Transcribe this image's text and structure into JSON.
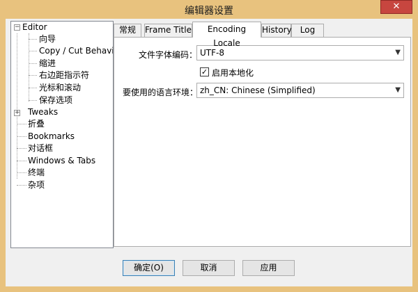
{
  "window": {
    "title": "编辑器设置",
    "close_label": "✕"
  },
  "tree": {
    "items": [
      {
        "label": "Editor",
        "expander": "⊟"
      },
      {
        "label": "向导"
      },
      {
        "label": "Copy / Cut Behavior"
      },
      {
        "label": "缩进"
      },
      {
        "label": "右边距指示符"
      },
      {
        "label": "光标和滚动"
      },
      {
        "label": "保存选项"
      },
      {
        "label": "Tweaks",
        "expander": "⊞"
      },
      {
        "label": "折叠"
      },
      {
        "label": "Bookmarks"
      },
      {
        "label": "对话框"
      },
      {
        "label": "Windows & Tabs"
      },
      {
        "label": "终端"
      },
      {
        "label": "杂项"
      }
    ]
  },
  "tabs": [
    {
      "label": "常规"
    },
    {
      "label": "Frame Title"
    },
    {
      "label": "Encoding  Locale"
    },
    {
      "label": "History"
    },
    {
      "label": "Log"
    }
  ],
  "panel": {
    "font_encoding_label": "文件字体编码：",
    "font_encoding_value": "UTF-8",
    "localization_label": "启用本地化",
    "localization_checked": true,
    "locale_label": "要使用的语言环境：",
    "locale_value": "zh_CN: Chinese (Simplified)"
  },
  "buttons": {
    "ok": "确定(O)",
    "cancel": "取消",
    "apply": "应用"
  },
  "colors": {
    "frame": "#e8c27e",
    "close": "#c7463f",
    "dialog_bg": "#f0f0f0"
  }
}
